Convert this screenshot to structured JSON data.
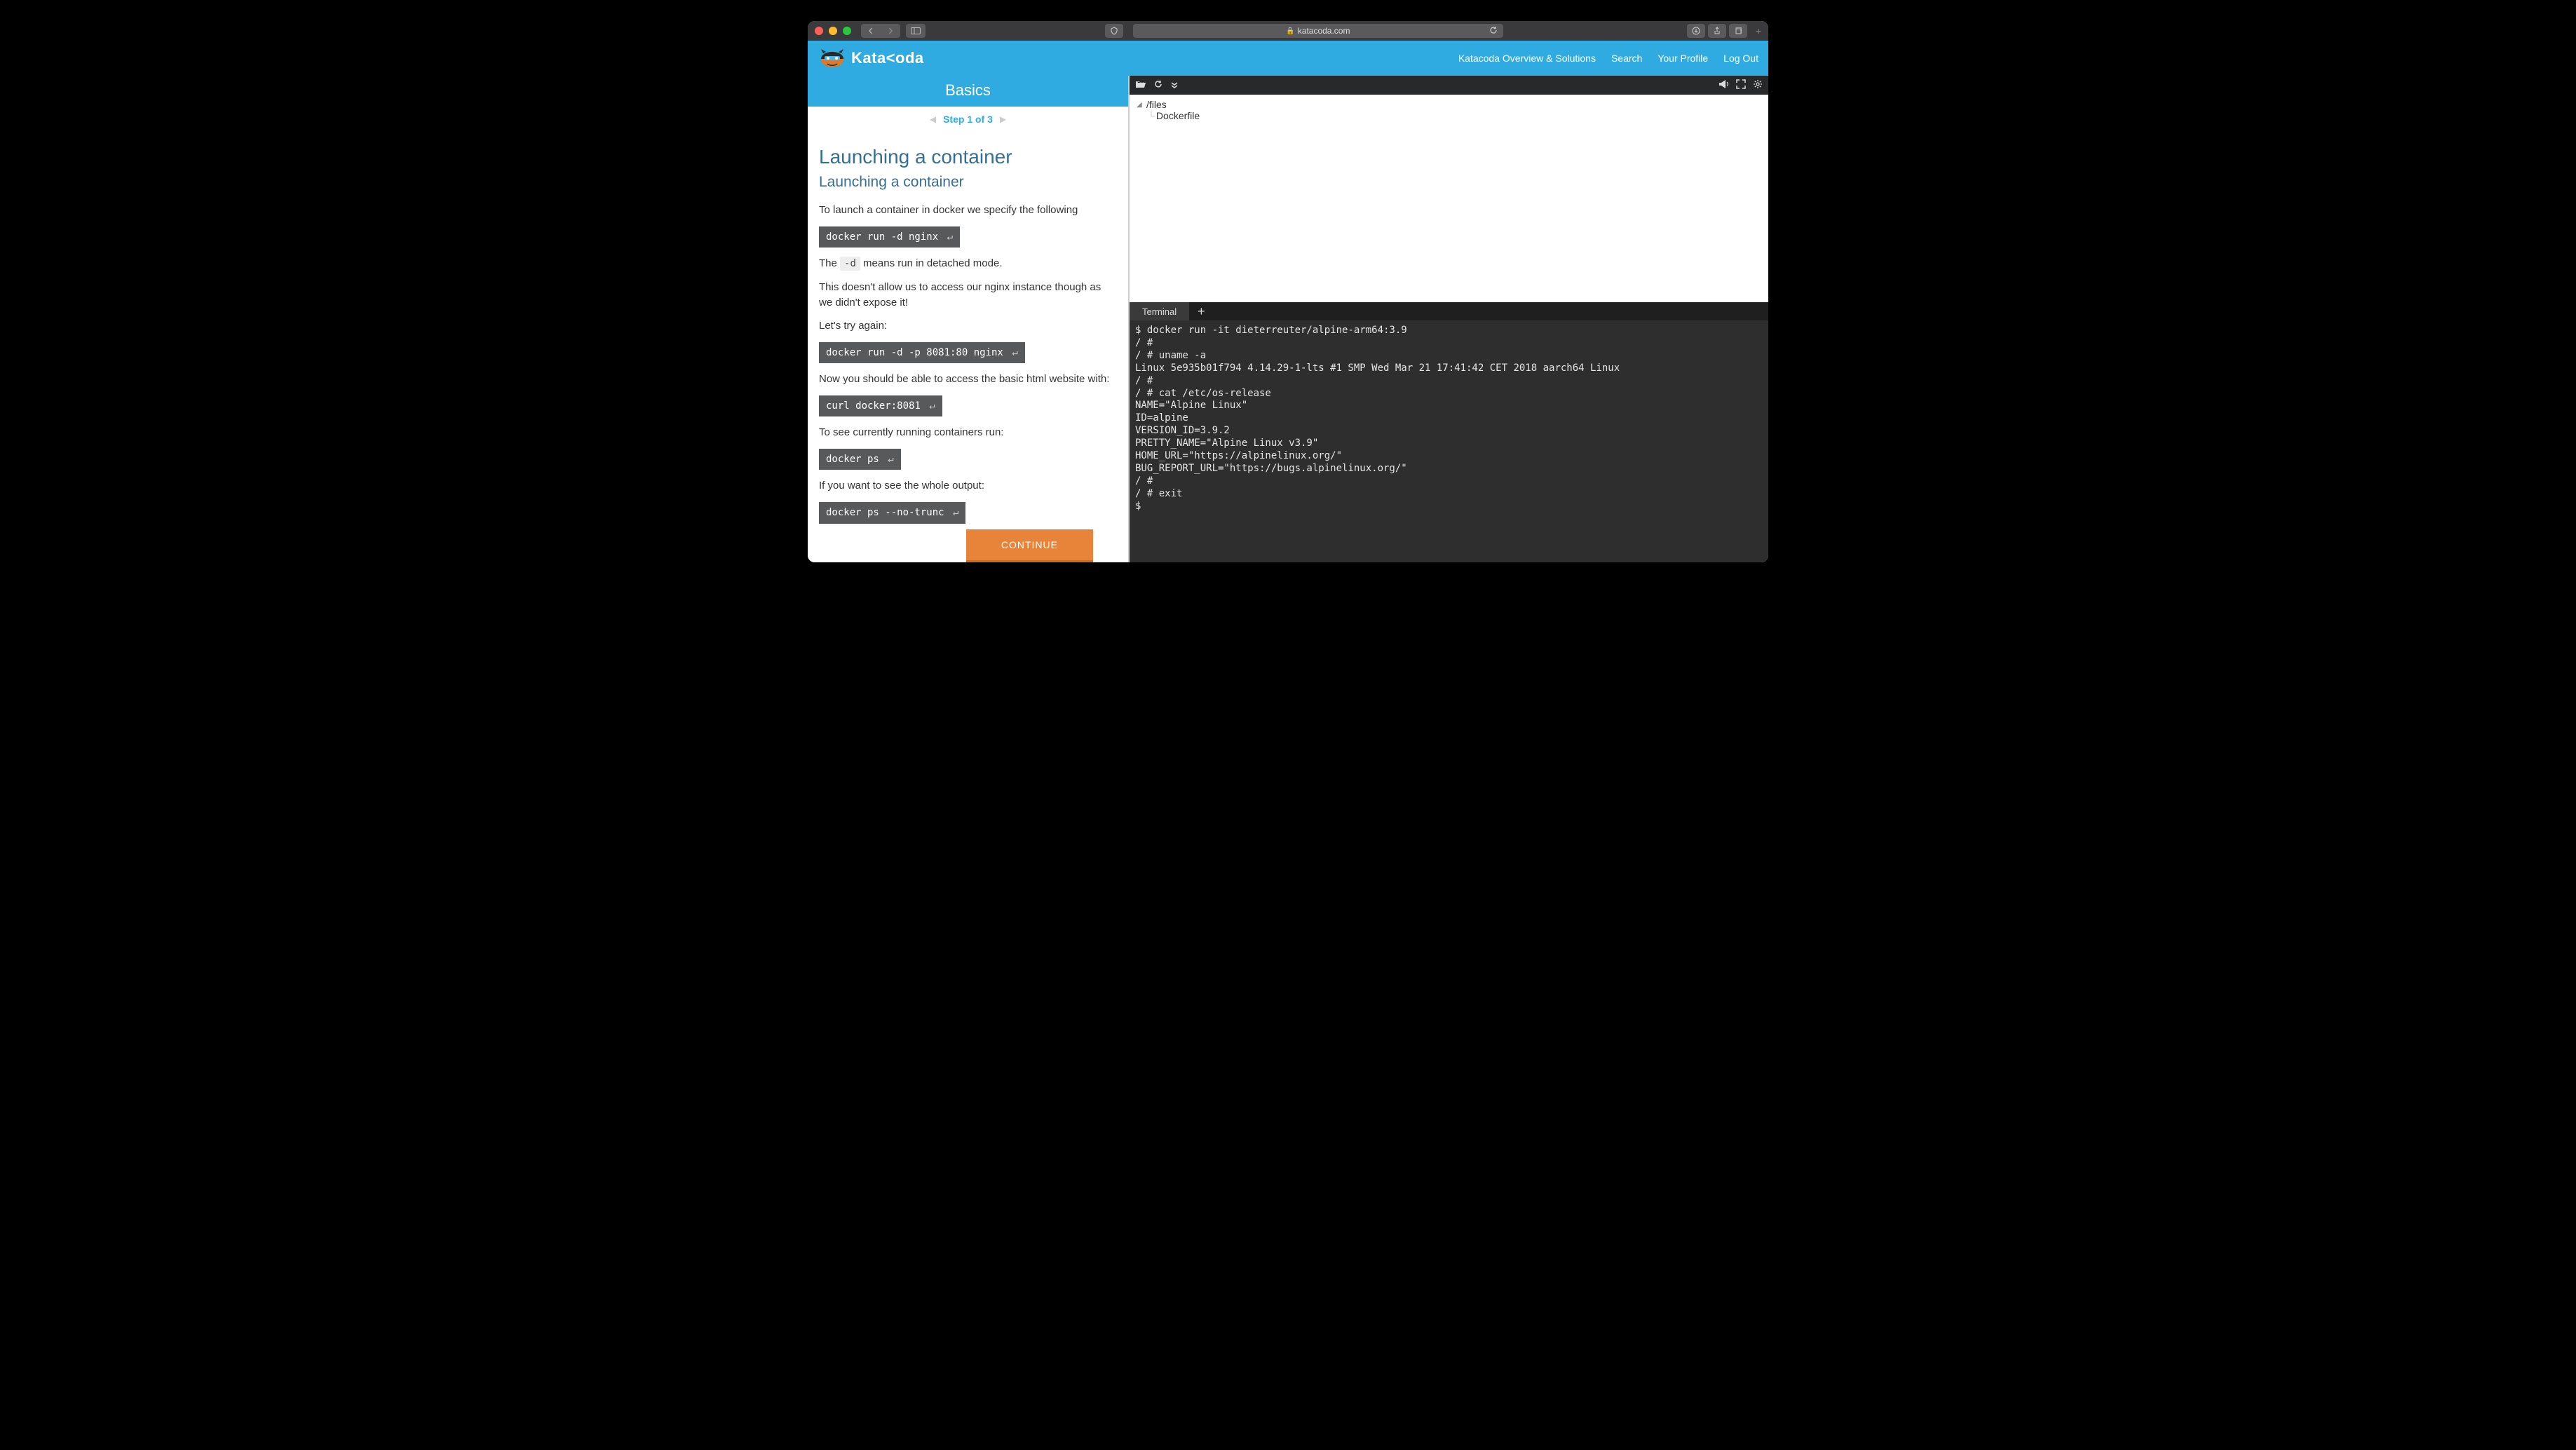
{
  "browser": {
    "url": "katacoda.com"
  },
  "header": {
    "brand": "Kata<oda",
    "nav": {
      "overview": "Katacoda Overview & Solutions",
      "search": "Search",
      "profile": "Your Profile",
      "logout": "Log Out"
    }
  },
  "sidebar": {
    "title": "Basics",
    "step_label": "Step 1 of 3"
  },
  "lesson": {
    "h1": "Launching a container",
    "h2": "Launching a container",
    "p1": "To launch a container in docker we specify the following",
    "code1": "docker run -d nginx",
    "p2_pre": "The ",
    "p2_code": "-d",
    "p2_post": " means run in detached mode.",
    "p3": "This doesn't allow us to access our nginx instance though as we didn't expose it!",
    "p4": "Let's try again:",
    "code2": "docker run -d -p 8081:80 nginx",
    "p5": "Now you should be able to access the basic html website with:",
    "code3": "curl docker:8081",
    "p6": "To see currently running containers run:",
    "code4": "docker ps",
    "p7": "If you want to see the whole output:",
    "code5": "docker ps --no-trunc",
    "continue": "CONTINUE"
  },
  "file_tree": {
    "root": "/files",
    "child": "Dockerfile"
  },
  "terminal": {
    "tab_name": "Terminal",
    "lines": [
      "$ docker run -it dieterreuter/alpine-arm64:3.9",
      "/ #",
      "/ # uname -a",
      "Linux 5e935b01f794 4.14.29-1-lts #1 SMP Wed Mar 21 17:41:42 CET 2018 aarch64 Linux",
      "/ #",
      "/ # cat /etc/os-release",
      "NAME=\"Alpine Linux\"",
      "ID=alpine",
      "VERSION_ID=3.9.2",
      "PRETTY_NAME=\"Alpine Linux v3.9\"",
      "HOME_URL=\"https://alpinelinux.org/\"",
      "BUG_REPORT_URL=\"https://bugs.alpinelinux.org/\"",
      "/ #",
      "/ # exit",
      "$"
    ]
  }
}
